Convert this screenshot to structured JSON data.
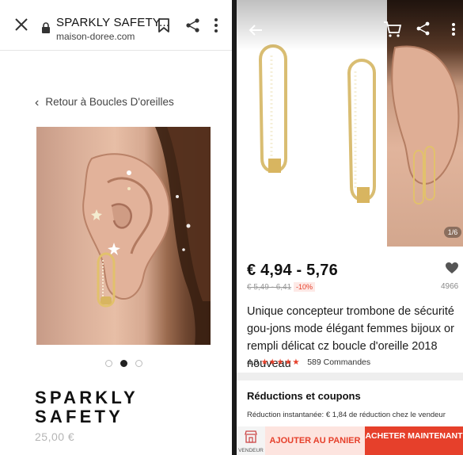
{
  "left_panel": {
    "browser": {
      "title": "SPARKLY SAFETY...",
      "url": "maison-doree.com"
    },
    "back_link": "Retour à Boucles D'oreilles",
    "carousel": {
      "count": 3,
      "active": 2
    },
    "product": {
      "name": "SPARKLY SAFETY",
      "price": "25,00 €"
    }
  },
  "right_panel": {
    "image_counter": "1/6",
    "price_range": "€ 4,94 - 5,76",
    "old_price": "€ 5,49 - 6,41",
    "discount": "-10%",
    "wishlist_count": "4966",
    "description": "Unique concepteur trombone de sécurité gou-jons mode élégant femmes bijoux or rempli délicat cz boucle d'oreille 2018 nouveau",
    "rating": {
      "score": "4.8",
      "stars": "★★★★★",
      "orders": "589 Commandes"
    },
    "coupons": {
      "title": "Réductions et coupons",
      "text": "Réduction instantanée: € 1,84 de réduction chez le vendeur"
    },
    "bottom_bar": {
      "store_label": "VENDEUR",
      "add_to_cart": "AJOUTER AU PANIER",
      "buy_now": "ACHETER MAINTENANT"
    }
  },
  "colors": {
    "accent": "#e6402b",
    "accent_light": "#fde4df",
    "gold": "#d8b560"
  }
}
